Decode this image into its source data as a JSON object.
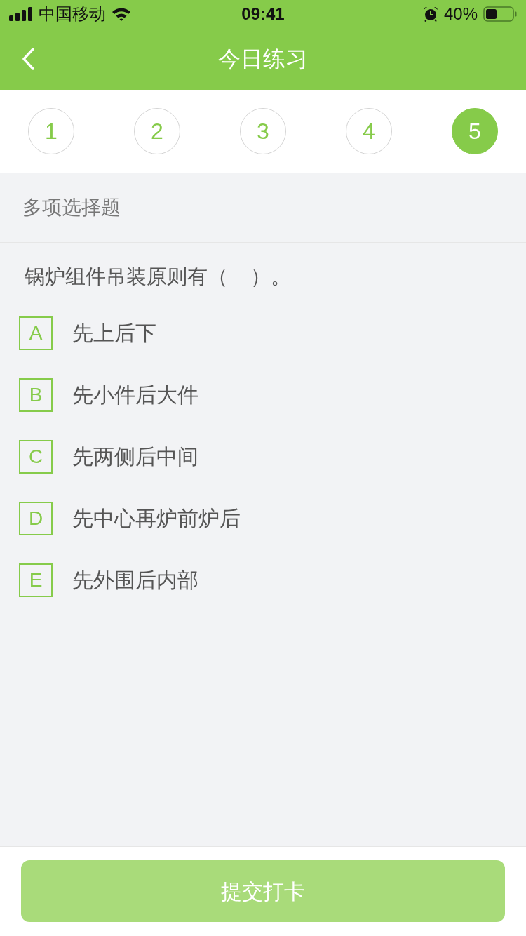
{
  "status_bar": {
    "carrier": "中国移动",
    "time": "09:41",
    "battery": "40%"
  },
  "nav_bar": {
    "title": "今日练习"
  },
  "question_tabs": [
    {
      "label": "1",
      "selected": false
    },
    {
      "label": "2",
      "selected": false
    },
    {
      "label": "3",
      "selected": false
    },
    {
      "label": "4",
      "selected": false
    },
    {
      "label": "5",
      "selected": true
    }
  ],
  "section": {
    "title": "多项选择题"
  },
  "question": {
    "text": "锅炉组件吊装原则有（    ）。",
    "options": [
      {
        "letter": "A",
        "text": "先上后下",
        "selected": false
      },
      {
        "letter": "B",
        "text": "先小件后大件",
        "selected": false
      },
      {
        "letter": "C",
        "text": "先两侧后中间",
        "selected": false
      },
      {
        "letter": "D",
        "text": "先中心再炉前炉后",
        "selected": false
      },
      {
        "letter": "E",
        "text": "先外围后内部",
        "selected": false
      }
    ]
  },
  "submit_button": {
    "label": "提交打卡",
    "disabled": true
  }
}
